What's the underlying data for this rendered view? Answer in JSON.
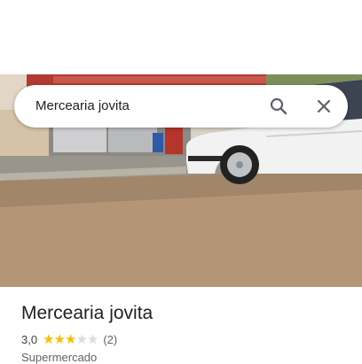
{
  "search": {
    "query": "Mercearia jovita"
  },
  "place": {
    "name": "Mercearia jovita",
    "rating_value": "3,0",
    "rating_stars": 3,
    "rating_max": 5,
    "review_count": "(2)",
    "category": "Supermercado"
  },
  "icons": {
    "search": "search-icon",
    "close": "close-icon",
    "star": "star-icon"
  },
  "colors": {
    "star_on": "#fbbc04",
    "star_off": "#dadce0"
  }
}
